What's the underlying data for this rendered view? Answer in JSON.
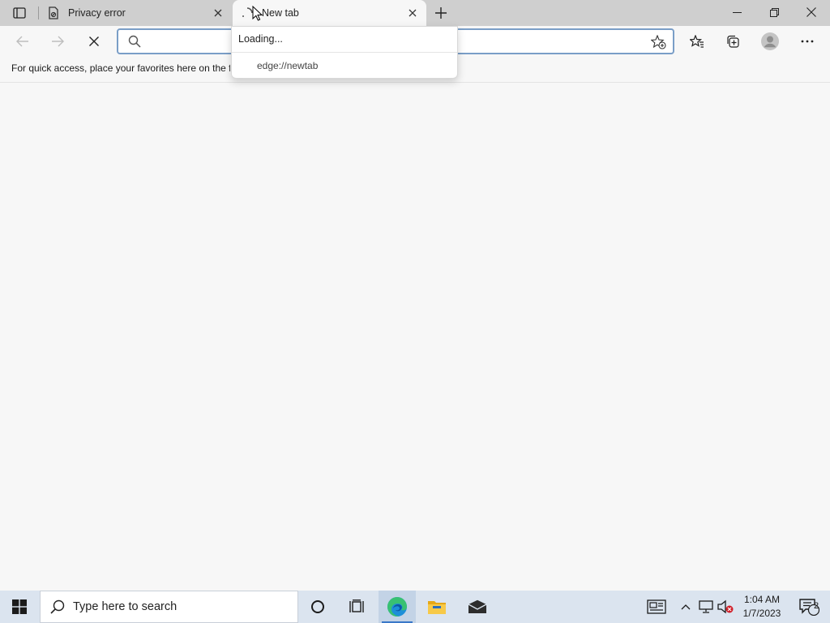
{
  "tabs": [
    {
      "title": "Privacy error",
      "favicon": "privacy-error-icon",
      "active": false
    },
    {
      "title": "New tab",
      "favicon": "loading-icon",
      "active": true
    }
  ],
  "address_bar": {
    "value": "",
    "placeholder": ""
  },
  "favorites_bar": {
    "text": "For quick access, place your favorites here on the f"
  },
  "dropdown": {
    "status": "Loading...",
    "items": [
      {
        "label": "edge://newtab"
      }
    ]
  },
  "taskbar": {
    "search_placeholder": "Type here to search",
    "time": "1:04 AM",
    "date": "1/7/2023",
    "notification_count": "2"
  },
  "colors": {
    "accent": "#3a78c8",
    "address_border": "#7a9ec7",
    "taskbar": "#dbe4ef"
  }
}
